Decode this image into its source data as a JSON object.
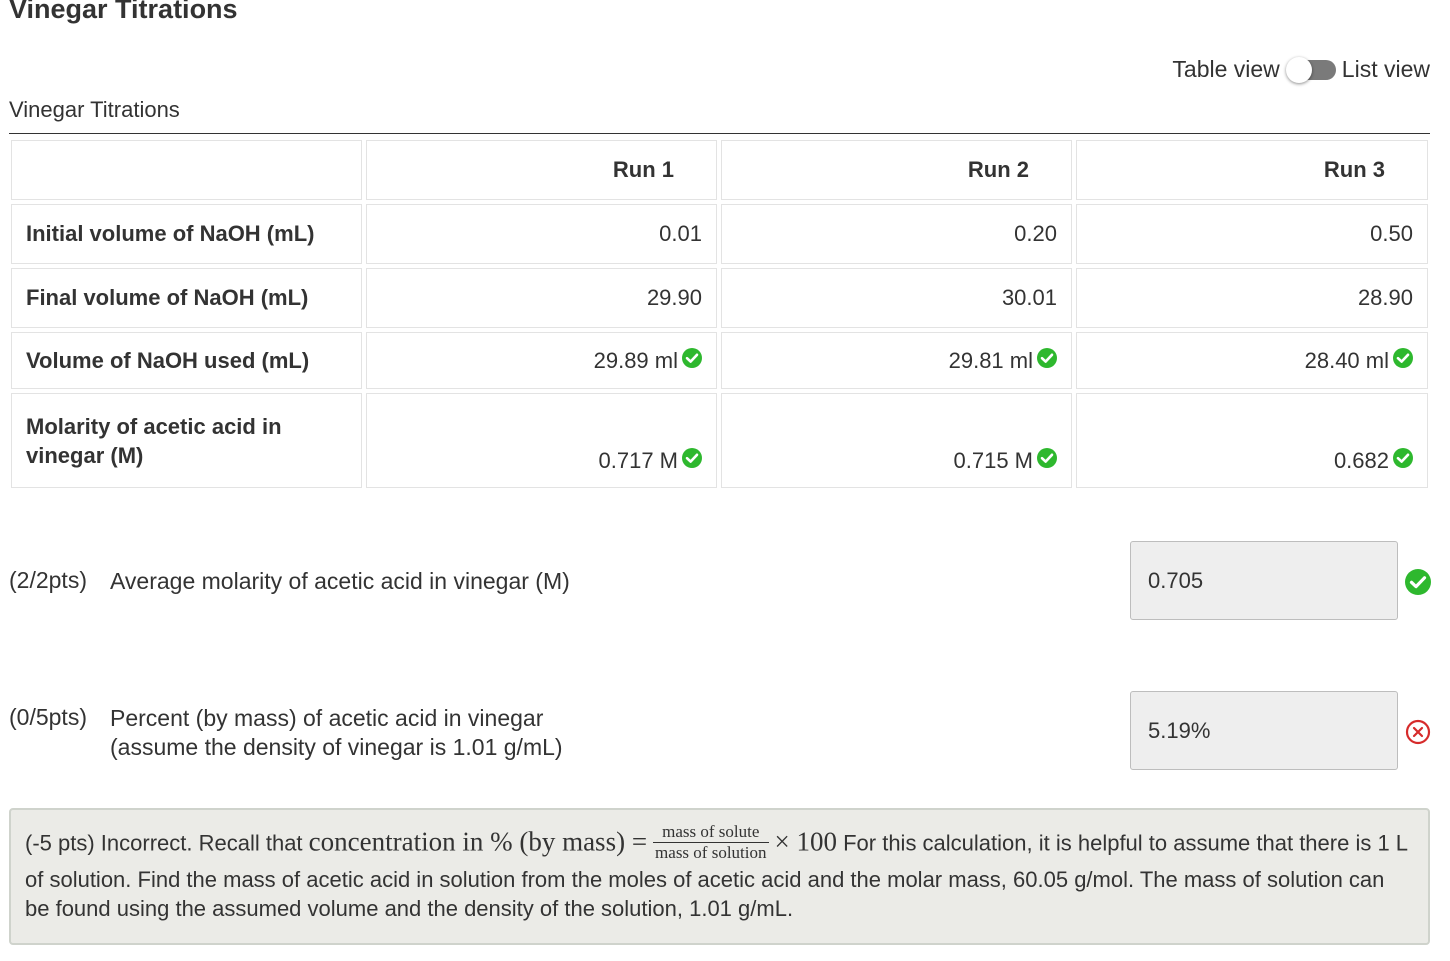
{
  "page": {
    "title": "Vinegar Titrations"
  },
  "view_toggle": {
    "left_label": "Table view",
    "right_label": "List view"
  },
  "section": {
    "label": "Vinegar Titrations"
  },
  "table": {
    "columns": [
      "Run 1",
      "Run 2",
      "Run 3"
    ],
    "rows": [
      {
        "label": "Initial volume of NaOH (mL)",
        "values": [
          "0.01",
          "0.20",
          "0.50"
        ],
        "checked": false
      },
      {
        "label": "Final volume of NaOH (mL)",
        "values": [
          "29.90",
          "30.01",
          "28.90"
        ],
        "checked": false
      },
      {
        "label": "Volume of NaOH used (mL)",
        "values": [
          "29.89 ml",
          "29.81 ml",
          "28.40 ml"
        ],
        "checked": true
      },
      {
        "label": "Molarity of acetic acid in vinegar (M)",
        "values": [
          "0.717 M",
          "0.715 M",
          "0.682"
        ],
        "checked": true
      }
    ]
  },
  "questions": [
    {
      "points": "(2/2pts)",
      "text": "Average molarity of acetic acid in vinegar (M)",
      "answer": "0.705",
      "status": "correct"
    },
    {
      "points": "(0/5pts)",
      "text_line1": "Percent (by mass) of acetic acid in vinegar",
      "text_line2": "(assume the density of vinegar is 1.01 g/mL)",
      "answer": "5.19%",
      "status": "incorrect"
    }
  ],
  "feedback": {
    "prefix": "(-5 pts) Incorrect. Recall that ",
    "formula_lhs": "concentration in % (by mass) =",
    "frac_num": "mass of solute",
    "frac_den": "mass of solution",
    "formula_rhs": "× 100",
    "suffix": " For this calculation, it is helpful to assume that there is 1 L of solution. Find the mass of acetic acid in solution from the moles of acetic acid and the molar mass, 60.05 g/mol. The mass of solution can be found using the assumed volume and the density of the solution, 1.01 g/mL."
  },
  "colors": {
    "correct": "#2eb82e",
    "incorrect": "#d62b2b",
    "toggle_track": "#7a7a7a",
    "feedback_bg": "#ebebe7"
  },
  "icons": {
    "correct": "check-circle-icon",
    "incorrect": "x-circle-icon"
  }
}
